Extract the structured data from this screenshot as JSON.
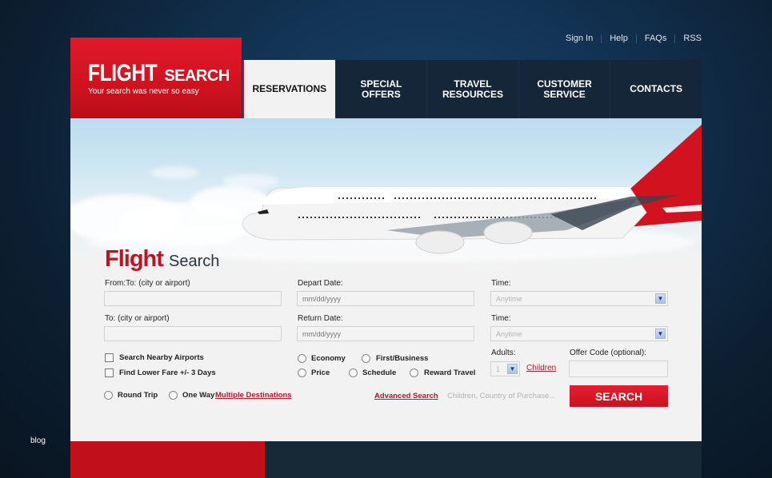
{
  "top_links": [
    {
      "label": "Sign In"
    },
    {
      "label": "Help"
    },
    {
      "label": "FAQs"
    },
    {
      "label": "RSS"
    }
  ],
  "logo": {
    "title_big": "FLIGHT",
    "title_small": "SEARCH",
    "tagline": "Your search was never so easy"
  },
  "nav": [
    {
      "label": "RESERVATIONS",
      "active": true
    },
    {
      "label": "SPECIAL\nOFFERS"
    },
    {
      "label": "TRAVEL\nRESOURCES"
    },
    {
      "label": "CUSTOMER\nSERVICE"
    },
    {
      "label": "CONTACTS"
    }
  ],
  "form": {
    "title_bold": "Flight",
    "title_light": "Search",
    "from_label": "From:To: (city or airport)",
    "from_value": "",
    "to_label": "To: (city or airport)",
    "to_value": "",
    "depart_label": "Depart Date:",
    "depart_placeholder": "mm/dd/yyyy",
    "return_label": "Return Date:",
    "return_placeholder": "mm/dd/yyyy",
    "time1_label": "Time:",
    "time1_value": "Anytime",
    "time2_label": "Time:",
    "time2_value": "Anytime",
    "checkboxes": [
      {
        "label": "Search Nearby Airports",
        "checked": false
      },
      {
        "label": "Find Lower Fare +/- 3 Days",
        "checked": false
      }
    ],
    "class_options": [
      {
        "label": "Economy"
      },
      {
        "label": "First/Business"
      }
    ],
    "sort_options": [
      {
        "label": "Price"
      },
      {
        "label": "Schedule"
      },
      {
        "label": "Reward Travel"
      }
    ],
    "trip_options": [
      {
        "label": "Round Trip"
      },
      {
        "label": "One Way"
      }
    ],
    "multiple_destinations_link": "Multiple Destinations",
    "adults_label": "Adults:",
    "adults_value": "1",
    "children_link": "Children",
    "offer_code_label": "Offer Code (optional):",
    "offer_code_value": "",
    "advanced_search_link": "Advanced Search",
    "advanced_hint": "Children, Country of Purchase...",
    "search_button": "SEARCH"
  },
  "side": {
    "blog_label": "blog"
  },
  "colors": {
    "brand_red": "#d0121f",
    "nav_dark": "#142638",
    "link_red": "#b01a2a"
  }
}
